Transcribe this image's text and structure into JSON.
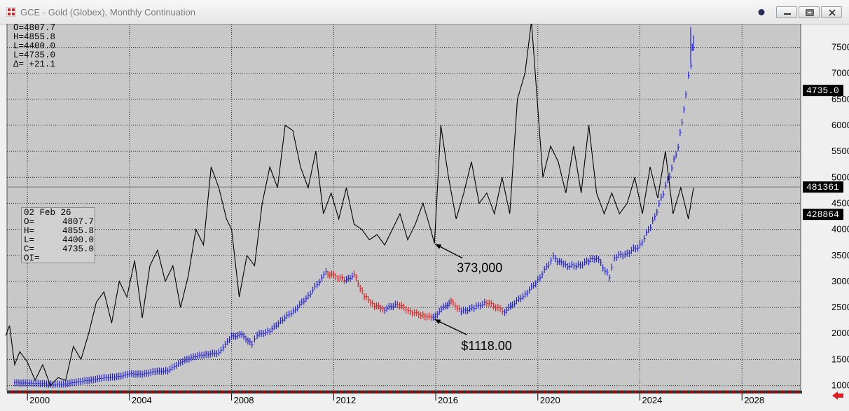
{
  "window": {
    "title": "GCE - Gold (Globex), Monthly Continuation"
  },
  "info_box": {
    "rows": [
      {
        "label": "O=",
        "value": "4807.7"
      },
      {
        "label": "H=",
        "value": "4855.8"
      },
      {
        "label": "L=",
        "value": "4400.0"
      },
      {
        "label": "L=",
        "value": "4735.0"
      },
      {
        "label": "Δ=",
        "value": " +21.1"
      }
    ]
  },
  "data_window": {
    "date": "02 Feb 26",
    "rows": [
      {
        "label": "O=",
        "value": "4807.7"
      },
      {
        "label": "H=",
        "value": "4855.8"
      },
      {
        "label": "L=",
        "value": "4400.0"
      },
      {
        "label": "C=",
        "value": "4735.0"
      },
      {
        "label": "OI=",
        "value": ""
      }
    ]
  },
  "annotations": {
    "oi_low": "373,000",
    "price_low": "$1118.00"
  },
  "colors": {
    "plot_bg": "#c8c8c8",
    "price_up": "#1f1fd8",
    "price_down": "#e02020",
    "oi_line": "#000000",
    "grid": "#222222"
  },
  "chart_data": {
    "type": "line",
    "title": "",
    "xlabel": "",
    "ylabel": "",
    "x_ticks": [
      "2000",
      "2004",
      "2008",
      "2012",
      "2016",
      "2020",
      "2024",
      "2028"
    ],
    "xlim": [
      1999.2,
      2030.3
    ],
    "y_ticks": [
      "100000",
      "150000",
      "200000",
      "250000",
      "300000",
      "350000",
      "400000",
      "450000",
      "500000",
      "550000",
      "600000",
      "650000",
      "700000",
      "750000"
    ],
    "ylim": [
      90000,
      795000
    ],
    "last_price_label": "4735.0",
    "oi_labels": [
      "481361",
      "428864"
    ],
    "oi_markers": [
      481361,
      428864
    ],
    "price_axis_value": 4735.0,
    "series": [
      {
        "style": "bars",
        "x": [
          1999.5,
          2000.0,
          2000.5,
          2001.0,
          2001.5,
          2002.0,
          2002.5,
          2003.0,
          2003.5,
          2004.0,
          2004.5,
          2005.0,
          2005.5,
          2006.0,
          2006.5,
          2007.0,
          2007.5,
          2008.0,
          2008.4,
          2008.8,
          2009.0,
          2009.5,
          2010.0,
          2010.5,
          2011.0,
          2011.7,
          2012.0,
          2012.5,
          2012.8,
          2013.2,
          2013.6,
          2014.0,
          2014.5,
          2015.0,
          2015.5,
          2015.9,
          2016.3,
          2016.6,
          2017.0,
          2017.5,
          2018.0,
          2018.7,
          2019.0,
          2019.5,
          2020.0,
          2020.6,
          2021.0,
          2021.5,
          2022.0,
          2022.3,
          2022.8,
          2023.0,
          2023.5,
          2024.0,
          2024.5,
          2025.0,
          2025.5,
          2025.8,
          2026.0,
          2026.1
        ],
        "y": [
          285,
          280,
          275,
          265,
          270,
          300,
          320,
          350,
          360,
          400,
          395,
          430,
          440,
          550,
          620,
          650,
          670,
          880,
          900,
          780,
          900,
          950,
          1100,
          1230,
          1400,
          1700,
          1660,
          1600,
          1680,
          1400,
          1280,
          1230,
          1300,
          1200,
          1150,
          1118,
          1250,
          1330,
          1200,
          1250,
          1320,
          1200,
          1290,
          1420,
          1600,
          1900,
          1800,
          1780,
          1850,
          1900,
          1650,
          1900,
          1950,
          2050,
          2350,
          2800,
          3300,
          4000,
          4400,
          4735
        ]
      },
      {
        "style": "line",
        "x": [
          1999.1,
          1999.3,
          1999.5,
          1999.7,
          2000.0,
          2000.3,
          2000.6,
          2000.9,
          2001.2,
          2001.5,
          2001.8,
          2002.1,
          2002.4,
          2002.7,
          2003.0,
          2003.3,
          2003.6,
          2003.9,
          2004.2,
          2004.5,
          2004.8,
          2005.1,
          2005.4,
          2005.7,
          2006.0,
          2006.3,
          2006.6,
          2006.9,
          2007.2,
          2007.5,
          2007.8,
          2008.0,
          2008.3,
          2008.6,
          2008.9,
          2009.2,
          2009.5,
          2009.8,
          2010.1,
          2010.4,
          2010.7,
          2011.0,
          2011.3,
          2011.6,
          2011.9,
          2012.2,
          2012.5,
          2012.8,
          2013.1,
          2013.4,
          2013.7,
          2014.0,
          2014.3,
          2014.6,
          2014.9,
          2015.2,
          2015.5,
          2015.8,
          2015.95,
          2016.2,
          2016.5,
          2016.8,
          2017.1,
          2017.4,
          2017.7,
          2018.0,
          2018.3,
          2018.6,
          2018.9,
          2019.2,
          2019.5,
          2019.75,
          2019.9,
          2020.2,
          2020.5,
          2020.8,
          2021.1,
          2021.4,
          2021.7,
          2022.0,
          2022.3,
          2022.6,
          2022.9,
          2023.2,
          2023.5,
          2023.8,
          2024.1,
          2024.4,
          2024.7,
          2025.0,
          2025.3,
          2025.6,
          2025.9,
          2026.1
        ],
        "y": [
          190000,
          215000,
          140000,
          165000,
          145000,
          110000,
          140000,
          100000,
          115000,
          110000,
          175000,
          150000,
          200000,
          260000,
          280000,
          220000,
          300000,
          270000,
          340000,
          230000,
          330000,
          360000,
          300000,
          330000,
          250000,
          310000,
          400000,
          370000,
          520000,
          480000,
          420000,
          400000,
          270000,
          350000,
          330000,
          450000,
          520000,
          480000,
          600000,
          590000,
          520000,
          480000,
          550000,
          430000,
          470000,
          420000,
          480000,
          410000,
          400000,
          380000,
          390000,
          370000,
          400000,
          430000,
          380000,
          410000,
          450000,
          400000,
          373000,
          600000,
          500000,
          420000,
          470000,
          530000,
          450000,
          470000,
          430000,
          500000,
          430000,
          650000,
          700000,
          800000,
          700000,
          500000,
          560000,
          530000,
          470000,
          560000,
          470000,
          600000,
          470000,
          430000,
          470000,
          430000,
          450000,
          500000,
          430000,
          520000,
          460000,
          550000,
          430000,
          480000,
          420000,
          480000
        ]
      }
    ]
  }
}
